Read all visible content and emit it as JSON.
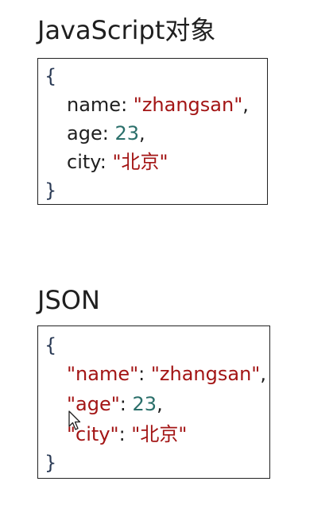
{
  "js_section": {
    "title": "JavaScript对象",
    "open_brace": "{",
    "close_brace": "}",
    "lines": [
      {
        "key": "name",
        "sep": ": ",
        "value": "\"zhangsan\"",
        "trail": ","
      },
      {
        "key": "age",
        "sep": ": ",
        "value": "23",
        "trail": ","
      },
      {
        "key": "city",
        "sep": ": ",
        "value": "\"北京\"",
        "trail": ""
      }
    ]
  },
  "json_section": {
    "title": "JSON",
    "open_brace": "{",
    "close_brace": "}",
    "lines": [
      {
        "key": "\"name\"",
        "sep": ": ",
        "value": "\"zhangsan\"",
        "trail": ","
      },
      {
        "key": "\"age\"",
        "sep": ": ",
        "value": "23",
        "trail": ","
      },
      {
        "key": "\"city\"",
        "sep": ": ",
        "value": "\"北京\"",
        "trail": ""
      }
    ]
  },
  "colors": {
    "string": "#a31515",
    "number": "#2a6f6a",
    "text": "#1f1f1f"
  },
  "cursor_icon": "mouse-pointer-icon"
}
